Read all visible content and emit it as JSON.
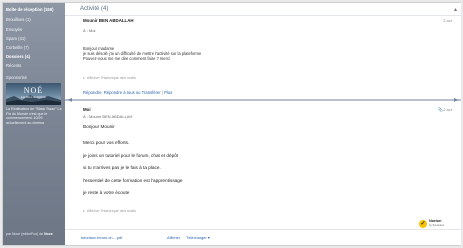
{
  "sidebar": {
    "folders": [
      {
        "label": "Boîte de réception (159)",
        "bold": true
      },
      {
        "label": "Brouillons (1)",
        "bold": false
      },
      {
        "label": "Envoyés",
        "bold": false
      },
      {
        "label": "Spam (41)",
        "bold": false
      },
      {
        "label": "Corbeille (7)",
        "bold": false
      },
      {
        "label": "Dossiers (4)",
        "bold": true
      },
      {
        "label": "Récents",
        "bold": false
      }
    ],
    "sponsor_label": "Sponsorisé",
    "ad": {
      "title": "NOÉ",
      "subtitle": "Les Films du Poisson",
      "text": "La Réalisateur de \"Black Swan\" La Fin du Monde n'est que le commencement. 10/29 actuellement au cinéma"
    },
    "footer": {
      "prefix": "par Noce (editorFoo) de",
      "brand": "Noce"
    }
  },
  "main": {
    "title": "Activité (4)",
    "message1": {
      "sender": "Mounir BEN ABDALLAH",
      "date": "2 avr.",
      "to": "À : Moi",
      "body": [
        "Bonjour madame",
        "je suis désolé j'ai un difficulté de mettre l'activité sur la plateforme",
        "Pouvez-vous me me dire comment faire ? merci"
      ],
      "history": "Afficher l'historique des mails"
    },
    "reply_links": {
      "reply": "Répondre, Répondre à tous ou Transférer",
      "sep": " | ",
      "more": "Plus"
    },
    "message2": {
      "sender": "Moi",
      "date": "2 avr.",
      "to": "À : Mounir BEN ABDALLAH",
      "body": [
        "Bonjour Mounir",
        "Merci pour vos efforts.",
        "je joins un tutoriel pour le forum, chat et dépôt",
        "si tu n'arrives pas je le fais à ta place.",
        "l'essentiel de cette formation est l'apprentissage",
        "je reste à votre écoute"
      ],
      "history": "Afficher l'historique des mails"
    },
    "attachment": {
      "filename": "tutoriaux-forum-ch....pdf",
      "afficher": "Afficher",
      "telecharger": "Télécharger ▾"
    },
    "norton": {
      "brand": "Norton",
      "sub": "by Symantec"
    }
  },
  "colors": {
    "sidebar": "#7b8594",
    "link": "#2a64ad",
    "divider": "#b9c2cc",
    "norton_yellow": "#f6c400"
  }
}
